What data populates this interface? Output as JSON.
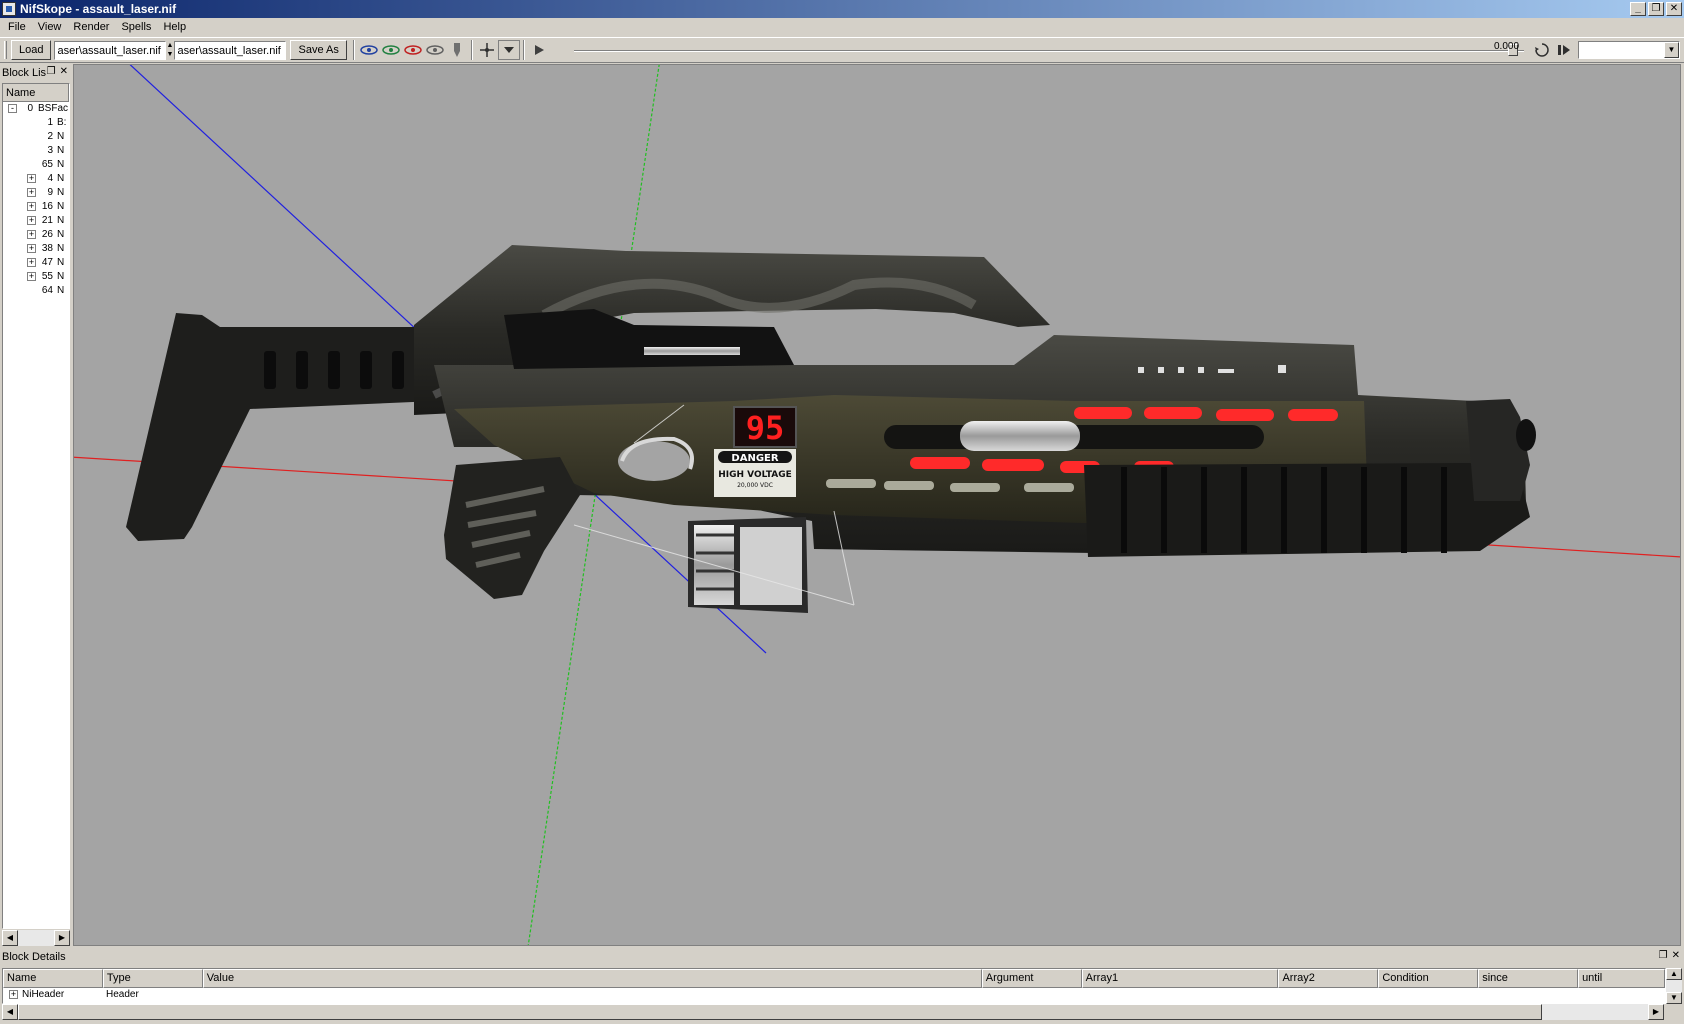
{
  "window": {
    "title": "NifSkope - assault_laser.nif",
    "controls": [
      "_",
      "❐",
      "✕"
    ]
  },
  "menu": [
    "File",
    "View",
    "Render",
    "Spells",
    "Help"
  ],
  "toolbar": {
    "load_label": "Load",
    "load_path": "aser\\assault_laser.nif",
    "save_path": "aser\\assault_laser.nif",
    "save_label": "Save As",
    "time_value": "0.000",
    "icons": [
      "view-front-icon",
      "view-side-icon",
      "view-top-icon",
      "view-user-icon",
      "toggle-lighting-icon",
      "move-axes-icon",
      "dropdown-icon",
      "play-icon"
    ]
  },
  "block_list": {
    "title": "Block Lis",
    "column": "Name",
    "rows": [
      {
        "num": "0",
        "type": "BSFac",
        "expander": "-",
        "level": 0
      },
      {
        "num": "1",
        "type": "B:",
        "expander": "",
        "level": 1
      },
      {
        "num": "2",
        "type": "N",
        "expander": "",
        "level": 1
      },
      {
        "num": "3",
        "type": "N",
        "expander": "",
        "level": 1
      },
      {
        "num": "65",
        "type": "N",
        "expander": "",
        "level": 1
      },
      {
        "num": "4",
        "type": "N",
        "expander": "+",
        "level": 1
      },
      {
        "num": "9",
        "type": "N",
        "expander": "+",
        "level": 1
      },
      {
        "num": "16",
        "type": "N",
        "expander": "+",
        "level": 1
      },
      {
        "num": "21",
        "type": "N",
        "expander": "+",
        "level": 1
      },
      {
        "num": "26",
        "type": "N",
        "expander": "+",
        "level": 1
      },
      {
        "num": "38",
        "type": "N",
        "expander": "+",
        "level": 1
      },
      {
        "num": "47",
        "type": "N",
        "expander": "+",
        "level": 1
      },
      {
        "num": "55",
        "type": "N",
        "expander": "+",
        "level": 1
      },
      {
        "num": "64",
        "type": "N",
        "expander": "",
        "level": 1
      }
    ]
  },
  "viewport": {
    "display_counter": "95",
    "decal_danger": "DANGER",
    "decal_voltage": "HIGH VOLTAGE",
    "decal_voltage_sub": "20,000 VDC",
    "colors": {
      "background": "#a4a4a4",
      "x_axis": "#e02020",
      "y_axis": "#20c020",
      "z_axis": "#2020e0",
      "glow": "#ff2a2a"
    }
  },
  "block_details": {
    "title": "Block Details",
    "columns": [
      "Name",
      "Type",
      "Value",
      "Argument",
      "Array1",
      "Array2",
      "Condition",
      "since",
      "until"
    ],
    "rows": [
      {
        "name": "NiHeader",
        "type": "Header",
        "expander": "+"
      }
    ]
  }
}
